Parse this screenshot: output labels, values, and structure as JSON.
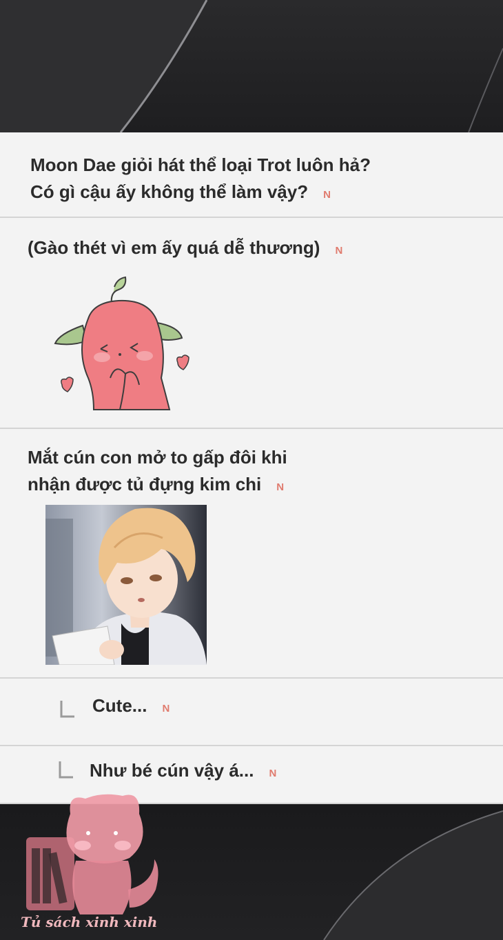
{
  "badge_label": "N",
  "posts": [
    {
      "lines": [
        "Moon Dae giỏi hát thể loại Trot luôn hả?",
        "Có gì cậu ấy không thể làm vậy?"
      ]
    },
    {
      "lines": [
        "(Gào thét vì em ấy quá dễ thương)"
      ],
      "attachment": "sticker-pink-blob-blushing"
    },
    {
      "lines": [
        "Mắt cún con mở to gấp đôi khi",
        "nhận được tủ đựng kim chi"
      ],
      "attachment": "photo-blond-boy-holding-paper"
    }
  ],
  "replies": [
    {
      "text": "Cute..."
    },
    {
      "text": "Như bé cún vậy á..."
    }
  ],
  "watermark": {
    "text": "Tủ sách xinh xinh",
    "icon": "pink-cat-bookshelf-logo"
  },
  "colors": {
    "badge": "#e07b6e",
    "feed_bg": "#f3f3f3",
    "text": "#2b2b2b",
    "frame": "#1b1b1d"
  }
}
